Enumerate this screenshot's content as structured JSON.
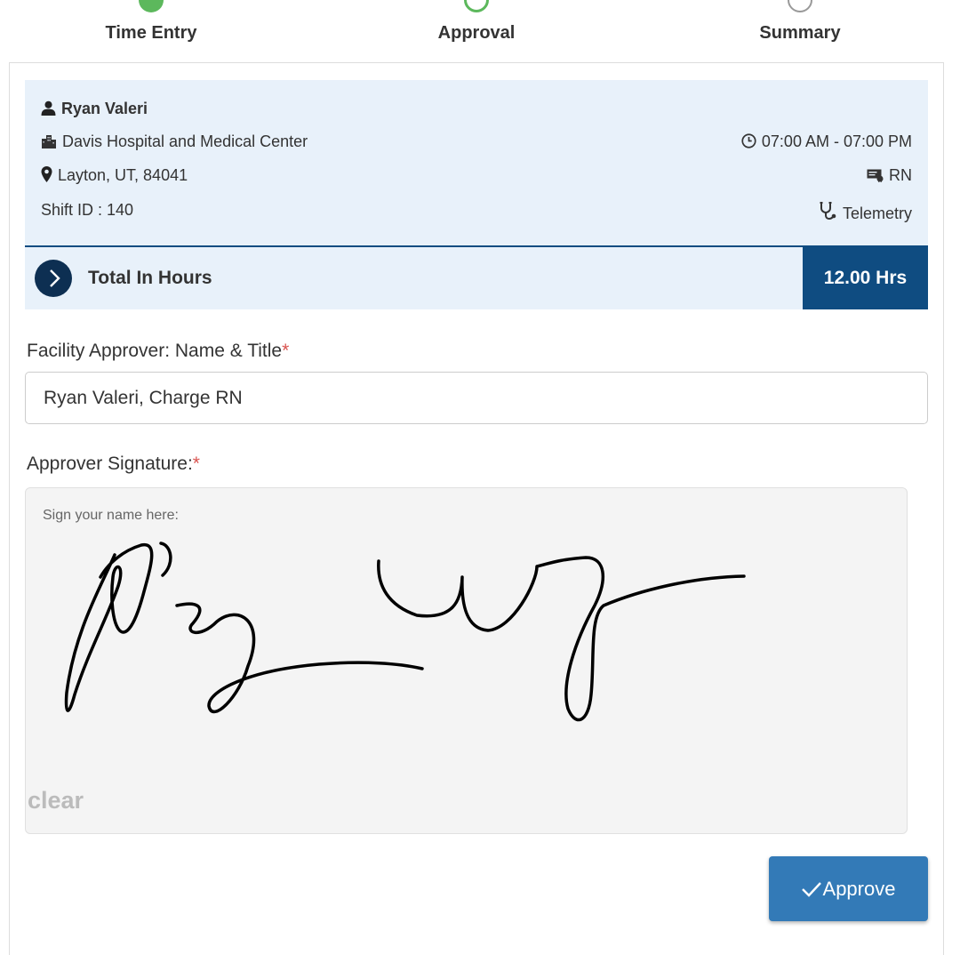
{
  "stepper": {
    "steps": [
      {
        "label": "Time Entry",
        "state": "done"
      },
      {
        "label": "Approval",
        "state": "active"
      },
      {
        "label": "Summary",
        "state": "todo"
      }
    ]
  },
  "shift": {
    "name": "Ryan Valeri",
    "facility": "Davis Hospital and Medical Center",
    "location": "Layton, UT, 84041",
    "shift_id": "Shift ID : 140",
    "time": "07:00 AM - 07:00 PM",
    "role": "RN",
    "unit": "Telemetry"
  },
  "total": {
    "label": "Total In Hours",
    "hours": "12.00 Hrs"
  },
  "form": {
    "approver_label": "Facility Approver: Name & Title",
    "approver_value": "Ryan Valeri, Charge RN",
    "signature_label": "Approver Signature:",
    "required_mark": "*",
    "signature_hint": "Sign your name here:",
    "clear_label": "clear",
    "approve_label": "Approve"
  },
  "colors": {
    "accent": "#337ab7",
    "navy": "#0f4c81",
    "success": "#5cb85c",
    "card_bg": "#e8f1fa",
    "required": "#d9534f"
  },
  "icons": [
    "user-icon",
    "building-icon",
    "map-marker-icon",
    "clock-icon",
    "badge-icon",
    "stethoscope-icon",
    "chevron-right-icon",
    "check-icon"
  ]
}
